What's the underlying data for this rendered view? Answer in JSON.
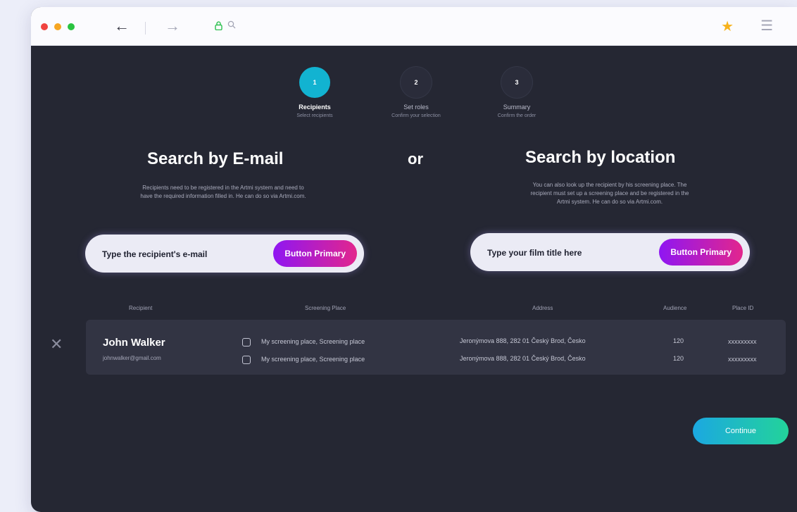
{
  "browser": {
    "icons": {
      "back": "arrow-left-icon",
      "forward": "arrow-right-icon",
      "lock": "lock-icon",
      "search": "search-icon",
      "bookmark": "star-icon",
      "menu": "hamburger-menu-icon"
    }
  },
  "steps": [
    {
      "number": "1",
      "title": "Recipients",
      "subtitle": "Select recipients",
      "active": true
    },
    {
      "number": "2",
      "title": "Set roles",
      "subtitle": "Confirm your selection",
      "active": false
    },
    {
      "number": "3",
      "title": "Summary",
      "subtitle": "Confirm the order",
      "active": false
    }
  ],
  "search_email": {
    "heading": "Search by E-mail",
    "description_line1": "Recipients need to be registered in the Artmi system and need to",
    "description_line2": "have the required information filled in. He can do so via Artmi.com.",
    "placeholder": "Type the recipient's e-mail",
    "button": "Button Primary"
  },
  "or_label": "or",
  "search_location": {
    "heading": "Search by location",
    "description_line1": "You can also look up the recipient by his screening place. The",
    "description_line2": "recipient must set up a screening place and be registered in the",
    "description_line3": "Artmi system. He can do so via Artmi.com.",
    "placeholder": "Type your film title here",
    "button": "Button Primary"
  },
  "table": {
    "headers": [
      "Recipient",
      "Screening Place",
      "Address",
      "Audience",
      "Place ID"
    ],
    "rows": [
      {
        "name": "John Walker",
        "email": "johnwalker@gmail.com",
        "places": [
          {
            "screening_place": "My screening place, Screening place",
            "address": "Jeronýmova 888, 282 01 Český Brod, Česko",
            "audience": "120",
            "place_id": "xxxxxxxxx"
          },
          {
            "screening_place": "My screening place, Screening place",
            "address": "Jeronýmova 888, 282 01 Český Brod, Česko",
            "audience": "120",
            "place_id": "xxxxxxxxx"
          }
        ]
      }
    ]
  },
  "continue_label": "Continue",
  "colors": {
    "background": "#252733",
    "accent_step": "#12b3d1",
    "primary_gradient_start": "#8f16f2",
    "primary_gradient_end": "#e2268d",
    "continue_gradient_start": "#1ba8e1",
    "continue_gradient_end": "#23d39a"
  }
}
